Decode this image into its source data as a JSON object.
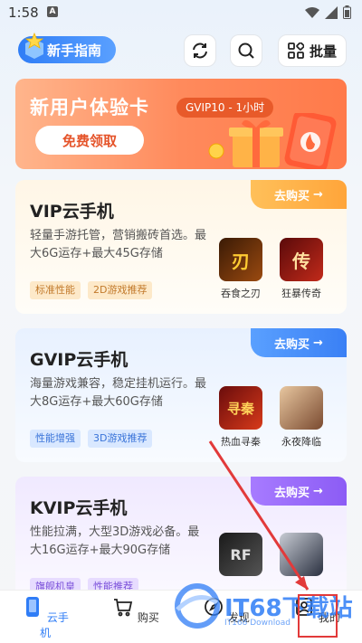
{
  "status": {
    "time": "1:58",
    "notif": "A"
  },
  "topbar": {
    "guide_label": "新手指南",
    "batch_label": "批量"
  },
  "banner": {
    "title": "新用户体验卡",
    "pill": "GVIP10 - 1小时",
    "claim": "免费领取"
  },
  "cards": [
    {
      "title": "VIP云手机",
      "desc": "轻量手游托管，营销搬砖首选。最大6G运存+最大45G存储",
      "tags": [
        "标准性能",
        "2D游戏推荐"
      ],
      "buy": "去购买",
      "games": [
        {
          "name": "吞食之刃",
          "glyph": "刃"
        },
        {
          "name": "狂暴传奇",
          "glyph": "传"
        }
      ]
    },
    {
      "title": "GVIP云手机",
      "desc": "海量游戏兼容，稳定挂机运行。最大8G运存+最大60G存储",
      "tags": [
        "性能增强",
        "3D游戏推荐"
      ],
      "buy": "去购买",
      "games": [
        {
          "name": "热血寻秦",
          "glyph": "寻秦"
        },
        {
          "name": "永夜降临",
          "glyph": ""
        }
      ]
    },
    {
      "title": "KVIP云手机",
      "desc": "性能拉满，大型3D游戏必备。最大16G运存+最大90G存储",
      "tags": [
        "旗舰机皇",
        "性能推荐"
      ],
      "buy": "去购买",
      "games": [
        {
          "name": "RF",
          "glyph": "RF"
        },
        {
          "name": "",
          "glyph": ""
        }
      ]
    }
  ],
  "tabbar": {
    "items": [
      {
        "label": "云手机",
        "icon": "phone-icon"
      },
      {
        "label": "购买",
        "icon": "cart-icon"
      },
      {
        "label": "发现",
        "icon": "discover-icon"
      },
      {
        "label": "我的",
        "icon": "user-icon"
      }
    ]
  },
  "watermark": {
    "brand": "IT68下载站",
    "sub": "IT168 Download"
  },
  "colors": {
    "accent": "#2f7df6",
    "highlight": "#e23a3a"
  }
}
